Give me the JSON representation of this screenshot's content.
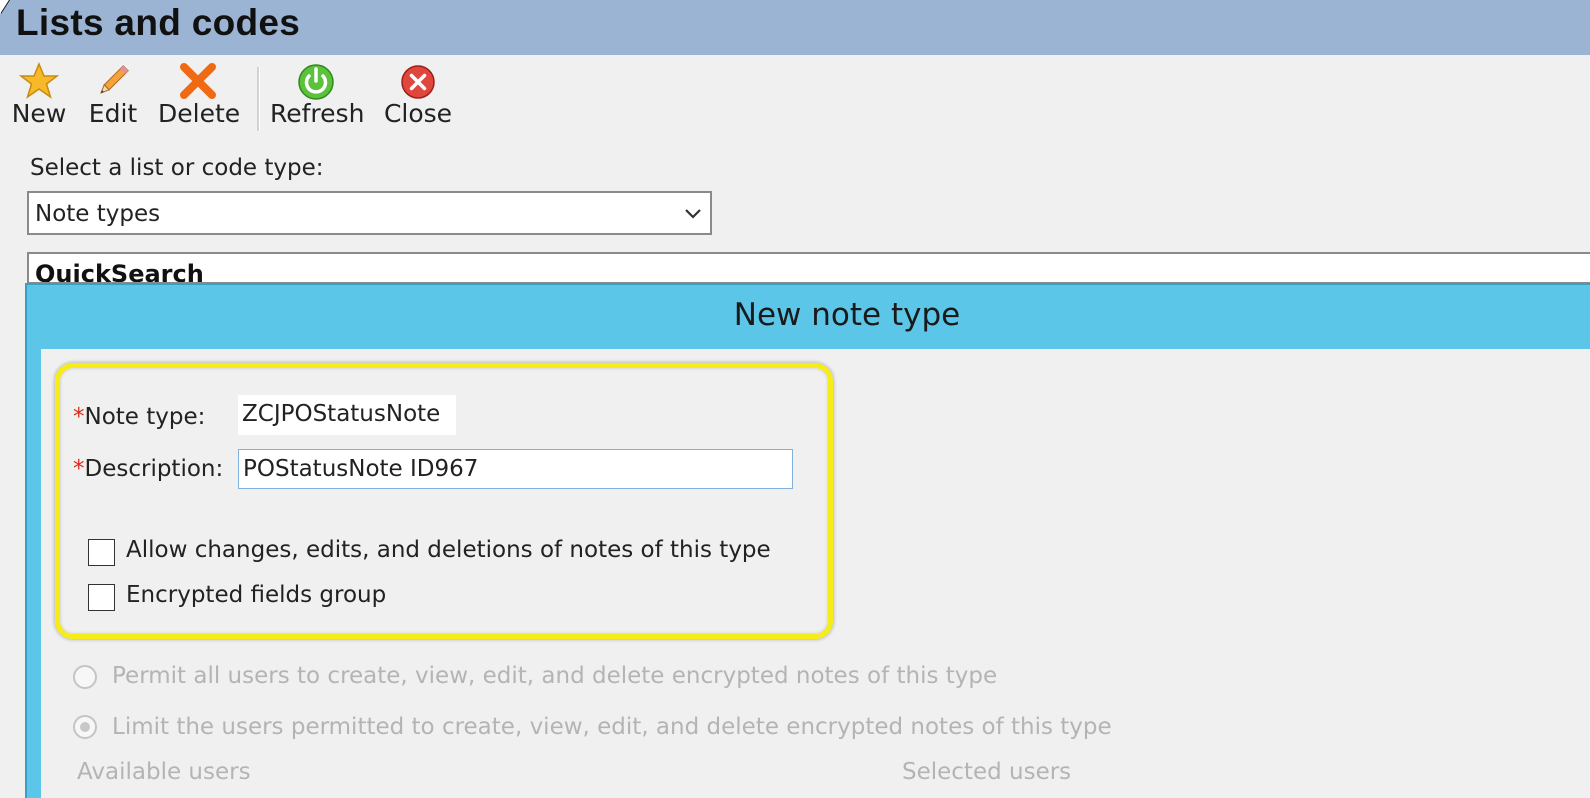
{
  "window": {
    "title": "Lists and codes"
  },
  "toolbar": {
    "buttons": [
      {
        "label": "New",
        "icon": "star-icon"
      },
      {
        "label": "Edit",
        "icon": "pencil-icon"
      },
      {
        "label": "Delete",
        "icon": "delete-x-icon"
      },
      {
        "label": "Refresh",
        "icon": "refresh-icon"
      },
      {
        "label": "Close",
        "icon": "close-circle-icon"
      }
    ]
  },
  "list_selector": {
    "label": "Select a list or code type:",
    "value": "Note types"
  },
  "quicksearch": {
    "label": "QuickSearch"
  },
  "dialog": {
    "title": "New note type",
    "note_type": {
      "label": "Note type:",
      "required_marker": "*",
      "value": "ZCJPOStatusNote"
    },
    "description": {
      "label": "Description:",
      "required_marker": "*",
      "value": "POStatusNote ID967"
    },
    "checkboxes": [
      {
        "label": "Allow changes, edits, and deletions of notes of this type",
        "checked": false
      },
      {
        "label": "Encrypted fields group",
        "checked": false
      }
    ],
    "permissions": [
      {
        "label": "Permit all users to create, view, edit, and delete encrypted notes of this type",
        "selected": false
      },
      {
        "label": "Limit the users permitted to create, view, edit, and delete encrypted notes of this type",
        "selected": true
      }
    ],
    "available_users_label": "Available users",
    "selected_users_label": "Selected users"
  },
  "colors": {
    "titlebar": "#9bb4d4",
    "dialog_header": "#5cc6e8",
    "highlight": "#f5ec18",
    "required": "#e0271a"
  }
}
